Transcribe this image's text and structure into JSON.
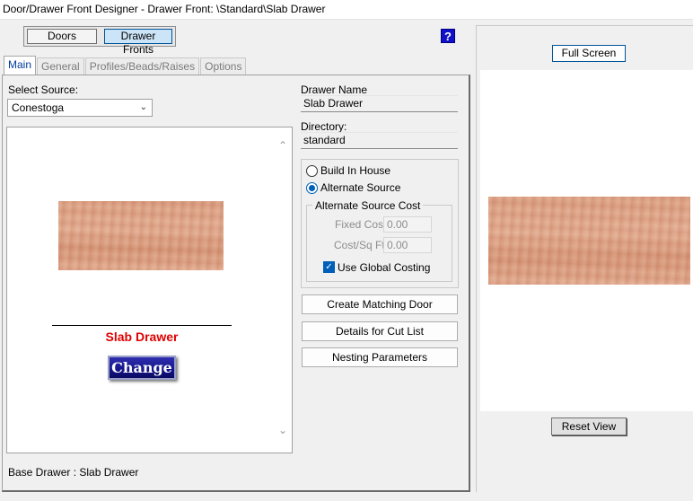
{
  "window": {
    "title": "Door/Drawer Front Designer - Drawer Front: \\Standard\\Slab Drawer"
  },
  "toggle": {
    "doors_label": "Doors",
    "drawer_fronts_label": "Drawer Fronts",
    "active": "Drawer Fronts"
  },
  "help": {
    "icon": "help-icon",
    "label": "?"
  },
  "tabs": [
    {
      "label": "Main",
      "active": true
    },
    {
      "label": "General",
      "active": false
    },
    {
      "label": "Profiles/Beads/Raises",
      "active": false
    },
    {
      "label": "Options",
      "active": false
    }
  ],
  "source": {
    "label": "Select Source:",
    "value": "Conestoga"
  },
  "preview": {
    "drawer_name": "Slab Drawer",
    "change_label": "Change"
  },
  "drawer": {
    "name_label": "Drawer Name",
    "name_value": "Slab Drawer",
    "directory_label": "Directory:",
    "directory_value": "standard"
  },
  "sourcing": {
    "build_in_house": "Build In House",
    "alternate_source": "Alternate Source",
    "selected": "Alternate Source",
    "cost_group_title": "Alternate Source Cost",
    "fixed_cost_label": "Fixed Cost",
    "fixed_cost_value": "0.00",
    "cost_sqft_label": "Cost/Sq Ft",
    "cost_sqft_value": "0.00",
    "use_global_label": "Use Global Costing",
    "use_global_checked": true
  },
  "actions": {
    "create_matching_door": "Create Matching Door",
    "details_cut_list": "Details for Cut List",
    "nesting_parameters": "Nesting Parameters"
  },
  "status": {
    "text": "Base Drawer : Slab Drawer"
  },
  "right_panel": {
    "full_screen_label": "Full Screen",
    "reset_view_label": "Reset View"
  },
  "colors": {
    "accent": "#005fb8",
    "drawer_name": "#e00000",
    "change_button": "#14148a"
  }
}
